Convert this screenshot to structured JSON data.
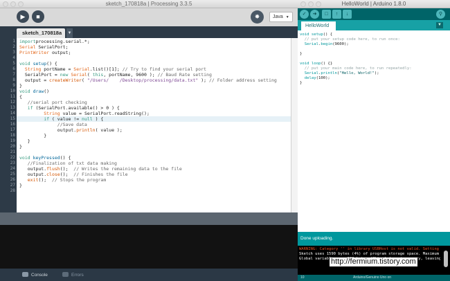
{
  "processing": {
    "window_title": "sketch_170818a | Processing 3.3.5",
    "mode_label": "Java",
    "tab_label": "sketch_170818a",
    "code_lines": [
      {
        "n": "1",
        "parts": [
          [
            "kw",
            "import"
          ],
          [
            "",
            "processing.serial.*;"
          ]
        ]
      },
      {
        "n": "2",
        "parts": [
          [
            "ty",
            "Serial"
          ],
          [
            "",
            " SerialPort;"
          ]
        ]
      },
      {
        "n": "3",
        "parts": [
          [
            "ty",
            "PrintWriter"
          ],
          [
            "",
            " output;"
          ]
        ]
      },
      {
        "n": "4",
        "parts": []
      },
      {
        "n": "5",
        "parts": [
          [
            "kw",
            "void "
          ],
          [
            "fn",
            "setup"
          ],
          [
            "",
            "() {"
          ]
        ]
      },
      {
        "n": "6",
        "parts": [
          [
            "",
            "  "
          ],
          [
            "ty",
            "String"
          ],
          [
            "",
            " portName = "
          ],
          [
            "ty",
            "Serial"
          ],
          [
            "",
            ".list()[1]; "
          ],
          [
            "cm",
            "// Try to find your serial port"
          ]
        ]
      },
      {
        "n": "7",
        "parts": [
          [
            "",
            "  SerialPort = "
          ],
          [
            "kw",
            "new "
          ],
          [
            "ty",
            "Serial"
          ],
          [
            "",
            "( "
          ],
          [
            "kw",
            "this"
          ],
          [
            "",
            ", portName, 9600 ); "
          ],
          [
            "cm",
            "// Baud Rate setting"
          ]
        ]
      },
      {
        "n": "8",
        "parts": [
          [
            "",
            "  output = "
          ],
          [
            "bfn",
            "createWriter"
          ],
          [
            "",
            "( "
          ],
          [
            "str",
            "\"/Users/    /Desktop/processing/data.txt\""
          ],
          [
            "",
            " ); "
          ],
          [
            "cm",
            "// Folder address setting"
          ]
        ]
      },
      {
        "n": "9",
        "parts": [
          [
            "",
            "}"
          ]
        ]
      },
      {
        "n": "10",
        "parts": [
          [
            "kw",
            "void "
          ],
          [
            "fn",
            "draw"
          ],
          [
            "",
            "()"
          ]
        ]
      },
      {
        "n": "11",
        "parts": [
          [
            "",
            "{"
          ]
        ]
      },
      {
        "n": "12",
        "parts": [
          [
            "cm",
            "   //serial port checking"
          ]
        ]
      },
      {
        "n": "13",
        "parts": [
          [
            "",
            "   "
          ],
          [
            "kw",
            "if"
          ],
          [
            "",
            " (SerialPort.available() > 0 ) {"
          ]
        ]
      },
      {
        "n": "14",
        "parts": [
          [
            "",
            "         "
          ],
          [
            "ty",
            "String"
          ],
          [
            "",
            " value = SerialPort.readString();"
          ]
        ]
      },
      {
        "n": "15",
        "parts": [
          [
            "",
            "         "
          ],
          [
            "kw",
            "if"
          ],
          [
            "",
            " ( value != "
          ],
          [
            "kw",
            "null"
          ],
          [
            "",
            " ) {"
          ]
        ]
      },
      {
        "n": "16",
        "parts": [
          [
            "cm",
            "              //Save data"
          ]
        ]
      },
      {
        "n": "17",
        "parts": [
          [
            "",
            "              output."
          ],
          [
            "bfn",
            "println"
          ],
          [
            "",
            "( value );"
          ]
        ]
      },
      {
        "n": "18",
        "parts": [
          [
            "",
            "         }"
          ]
        ]
      },
      {
        "n": "19",
        "parts": [
          [
            "",
            "   }"
          ]
        ]
      },
      {
        "n": "20",
        "parts": [
          [
            "",
            "}"
          ]
        ]
      },
      {
        "n": "21",
        "parts": []
      },
      {
        "n": "22",
        "parts": [
          [
            "kw",
            "void "
          ],
          [
            "fn",
            "keyPressed"
          ],
          [
            "",
            "() {"
          ]
        ]
      },
      {
        "n": "23",
        "parts": [
          [
            "cm",
            "   //Finalization of txt data making"
          ]
        ]
      },
      {
        "n": "24",
        "parts": [
          [
            "",
            "   output."
          ],
          [
            "bfn",
            "flush"
          ],
          [
            "",
            "();  "
          ],
          [
            "cm",
            "// Writes the remaining data to the file"
          ]
        ]
      },
      {
        "n": "25",
        "parts": [
          [
            "",
            "   output."
          ],
          [
            "bfn",
            "close"
          ],
          [
            "",
            "();  "
          ],
          [
            "cm",
            "// Finishes the file"
          ]
        ]
      },
      {
        "n": "26",
        "parts": [
          [
            "",
            "   "
          ],
          [
            "bfn",
            "exit"
          ],
          [
            "",
            "();  "
          ],
          [
            "cm",
            "// Stops the program"
          ]
        ]
      },
      {
        "n": "27",
        "parts": [
          [
            "",
            "}"
          ]
        ]
      },
      {
        "n": "28",
        "parts": []
      }
    ],
    "highlighted_line": 15,
    "console_tab_label": "Console",
    "errors_tab_label": "Errors"
  },
  "arduino": {
    "window_title": "HelloWorld | Arduino 1.8.0",
    "tab_label": "HelloWorld",
    "code_lines": [
      [
        [
          "ak",
          "void "
        ],
        [
          "ak",
          "setup"
        ],
        [
          "",
          "() {"
        ]
      ],
      [
        [
          "ac",
          "  // put your setup code here, to run once:"
        ]
      ],
      [
        [
          "",
          "  "
        ],
        [
          "ak",
          "Serial"
        ],
        [
          "",
          "."
        ],
        [
          "ak",
          "begin"
        ],
        [
          "",
          "(9600);"
        ]
      ],
      [],
      [
        [
          "",
          "}"
        ]
      ],
      [],
      [
        [
          "ak",
          "void "
        ],
        [
          "ak",
          "loop"
        ],
        [
          "",
          "() {"
        ],
        [
          "",
          "}"
        ]
      ],
      [
        [
          "ac",
          "  // put your main code here, to run repeatedly:"
        ]
      ],
      [
        [
          "",
          "  "
        ],
        [
          "ak",
          "Serial"
        ],
        [
          "",
          "."
        ],
        [
          "ak",
          "println"
        ],
        [
          "",
          "("
        ],
        [
          "astr",
          "\"Hello, World!\""
        ],
        [
          "",
          ");"
        ]
      ],
      [
        [
          "",
          "  "
        ],
        [
          "ak",
          "delay"
        ],
        [
          "",
          "(100);"
        ]
      ],
      [
        [
          "",
          "}"
        ]
      ]
    ],
    "status": "Done uploading.",
    "console_lines": [
      {
        "text": "WARNING: Category '' in library USBHost is not valid. Setting to",
        "color": "#e8542a"
      },
      {
        "text": "Sketch uses 1590 bytes (4%) of program storage space. Maximum is",
        "color": "#ffffff"
      },
      {
        "text": "Global variables use 198 bytes (9%) of dynamic memory, leaving 1",
        "color": "#ffffff"
      }
    ],
    "footer_line": "10",
    "footer_board": "Arduino/Genuino Uno on"
  },
  "watermark": "http://fermium.tistory.com"
}
